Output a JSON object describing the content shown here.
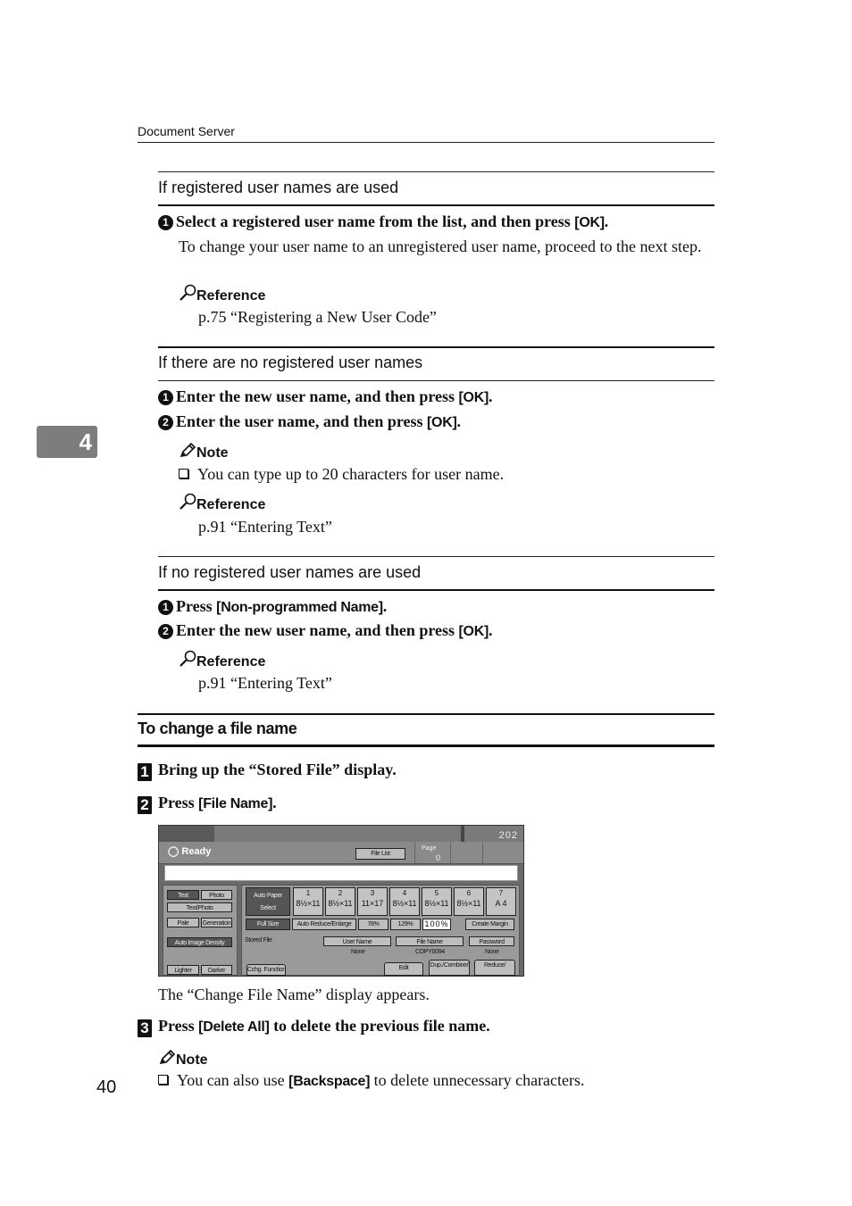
{
  "header": {
    "running_title": "Document Server"
  },
  "chapter_tab": "4",
  "page_number": "40",
  "sections": [
    {
      "subhead": "If registered user names are used",
      "steps": [
        {
          "num": "1",
          "text": "Select a registered user name from the list, and then press ",
          "key": "[OK]",
          "after": "."
        }
      ],
      "body": "To change your user name to an unregistered user name, proceed to the next step.",
      "reference": {
        "label": "Reference",
        "text": "p.75 “Registering a New User Code”"
      }
    },
    {
      "subhead": "If there are no registered user names",
      "steps": [
        {
          "num": "1",
          "text": "Enter the new user name, and then press ",
          "key": "[OK]",
          "after": "."
        },
        {
          "num": "2",
          "text": "Enter the user name, and then press ",
          "key": "[OK]",
          "after": "."
        }
      ],
      "note": {
        "label": "Note",
        "items": [
          "You can type up to 20 characters for user name."
        ]
      },
      "reference": {
        "label": "Reference",
        "text": "p.91 “Entering Text”"
      }
    },
    {
      "subhead": "If no registered user names are used",
      "steps": [
        {
          "num": "1",
          "text": "Press ",
          "key": "[Non-programmed Name]",
          "after": "."
        },
        {
          "num": "2",
          "text": "Enter the new user name, and then press ",
          "key": "[OK]",
          "after": "."
        }
      ],
      "reference": {
        "label": "Reference",
        "text": "p.91 “Entering Text”"
      }
    }
  ],
  "procedure": {
    "title": "To change a file name",
    "steps": [
      {
        "num": "1",
        "text": "Bring up the “Stored File” display."
      },
      {
        "num": "2",
        "text": "Press ",
        "key": "[File Name]",
        "after": "."
      },
      {
        "num": "3",
        "text": "Press ",
        "key": "[Delete All]",
        "after": " to delete the previous file name."
      }
    ],
    "after_screen": "The “Change File Name” display appears.",
    "note": {
      "label": "Note",
      "pre": "You can also use ",
      "key": "[Backspace]",
      "post": " to delete unnecessary characters."
    }
  },
  "screen": {
    "counter": "202",
    "status": "Ready",
    "file_list": "File List",
    "page_label": "Page",
    "page_value": "0",
    "buttons": {
      "text": "Text",
      "photo": "Photo",
      "text_photo": "Text/Photo",
      "pale": "Pale",
      "generation": "Generation",
      "auto_density": "Auto Image Density",
      "lighter": "Lighter",
      "darker": "Darker",
      "auto_paper": "Auto Paper Select",
      "full_size": "Full Size",
      "auto_reduce": "Auto Reduce/Enlarge",
      "r78": "78%",
      "r129": "129%",
      "r100": "100%",
      "create_margin": "Create Margin",
      "user_name": "User Name",
      "file_name": "File Name",
      "password": "Password",
      "cchg_function": "Cchg. Function",
      "edit": "Edit",
      "dup_combine": "Dup./Combine/",
      "reduce": "Reduce/"
    },
    "stored_file_label": "Stored File",
    "user_name_value": "None",
    "file_name_value": "COPY0094",
    "password_value": "None",
    "trays": [
      {
        "n": "1",
        "size": "8½×11"
      },
      {
        "n": "2",
        "size": "8½×11"
      },
      {
        "n": "3",
        "size": "11×17"
      },
      {
        "n": "4",
        "size": "8½×11"
      },
      {
        "n": "5",
        "size": "8½×11"
      },
      {
        "n": "6",
        "size": "8½×11"
      },
      {
        "n": "7",
        "size": "A 4"
      }
    ]
  }
}
